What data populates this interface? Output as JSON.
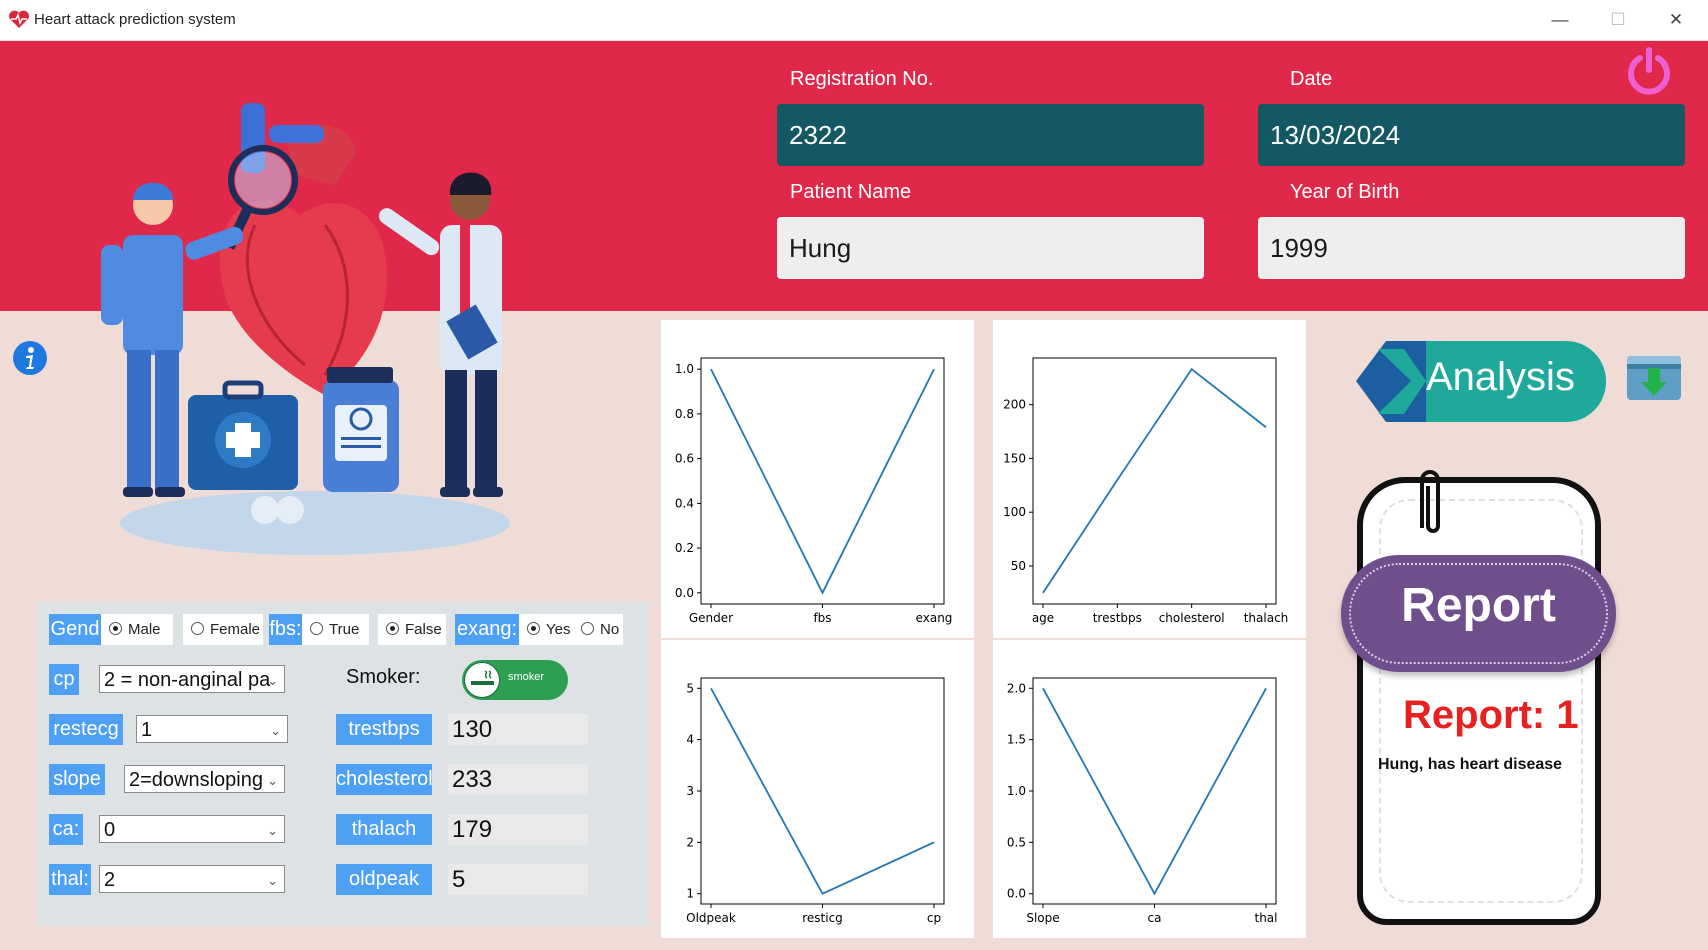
{
  "window": {
    "title": "Heart attack prediction system",
    "minimize": "—",
    "maximize": "☐",
    "close": "✕"
  },
  "header": {
    "registration_label": "Registration No.",
    "registration_value": "2322",
    "date_label": "Date",
    "date_value": "13/03/2024",
    "patient_label": "Patient Name",
    "patient_value": "Hung",
    "birth_label": "Year of Birth",
    "birth_value": "1999"
  },
  "form": {
    "gender_label": "Gend",
    "gender_options": [
      "Male",
      "Female"
    ],
    "gender_selected": "Male",
    "fbs_label": "fbs:",
    "fbs_options": [
      "True",
      "False"
    ],
    "fbs_selected": "False",
    "exang_label": "exang:",
    "exang_options": [
      "Yes",
      "No"
    ],
    "exang_selected": "Yes",
    "cp_label": "cp",
    "cp_value": "2 = non-anginal pa",
    "smoker_label": "Smoker:",
    "smoker_toggle_text": "smoker",
    "restecg_label": "restecg",
    "restecg_value": "1",
    "trestbps_label": "trestbps",
    "trestbps_value": "130",
    "slope_label": "slope",
    "slope_value": "2=downsloping",
    "cholesterol_label": "cholesterol",
    "cholesterol_value": "233",
    "ca_label": "ca:",
    "ca_value": "0",
    "thalach_label": "thalach",
    "thalach_value": "179",
    "thal_label": "thal:",
    "thal_value": "2",
    "oldpeak_label": "oldpeak",
    "oldpeak_value": "5"
  },
  "actions": {
    "analysis_label": "Analysis"
  },
  "report": {
    "badge": "Report",
    "result": "Report: 1",
    "message": "Hung, has heart disease"
  },
  "colors": {
    "banner": "#e0294a",
    "field_dark": "#135863",
    "label_blue": "#4ea0f5",
    "line": "#1f77b4",
    "report_red": "#e82020",
    "analysis_teal": "#1fa99a",
    "report_purple": "#6e4f8c"
  },
  "icons": {
    "app": "heart-icon",
    "power": "power-icon",
    "info": "info-icon",
    "download": "download-archive-icon",
    "smoker": "cigarette-icon",
    "clip": "paperclip-icon"
  },
  "chart_data": [
    {
      "type": "line",
      "categories": [
        "Gender",
        "fbs",
        "exang"
      ],
      "values": [
        1,
        0,
        1
      ],
      "ylim": [
        0,
        1
      ],
      "yticks": [
        "0.0",
        "0.2",
        "0.4",
        "0.6",
        "0.8",
        "1.0"
      ]
    },
    {
      "type": "line",
      "categories": [
        "age",
        "trestbps",
        "cholesterol",
        "thalach"
      ],
      "values": [
        25,
        130,
        233,
        179
      ],
      "ylim": [
        25,
        233
      ],
      "yticks": [
        "50",
        "100",
        "150",
        "200"
      ]
    },
    {
      "type": "line",
      "categories": [
        "Oldpeak",
        "resticg",
        "cp"
      ],
      "values": [
        5,
        1,
        2
      ],
      "ylim": [
        1,
        5
      ],
      "yticks": [
        "1",
        "2",
        "3",
        "4",
        "5"
      ]
    },
    {
      "type": "line",
      "categories": [
        "Slope",
        "ca",
        "thal"
      ],
      "values": [
        2,
        0,
        2
      ],
      "ylim": [
        0,
        2
      ],
      "yticks": [
        "0.0",
        "0.5",
        "1.0",
        "1.5",
        "2.0"
      ]
    }
  ]
}
